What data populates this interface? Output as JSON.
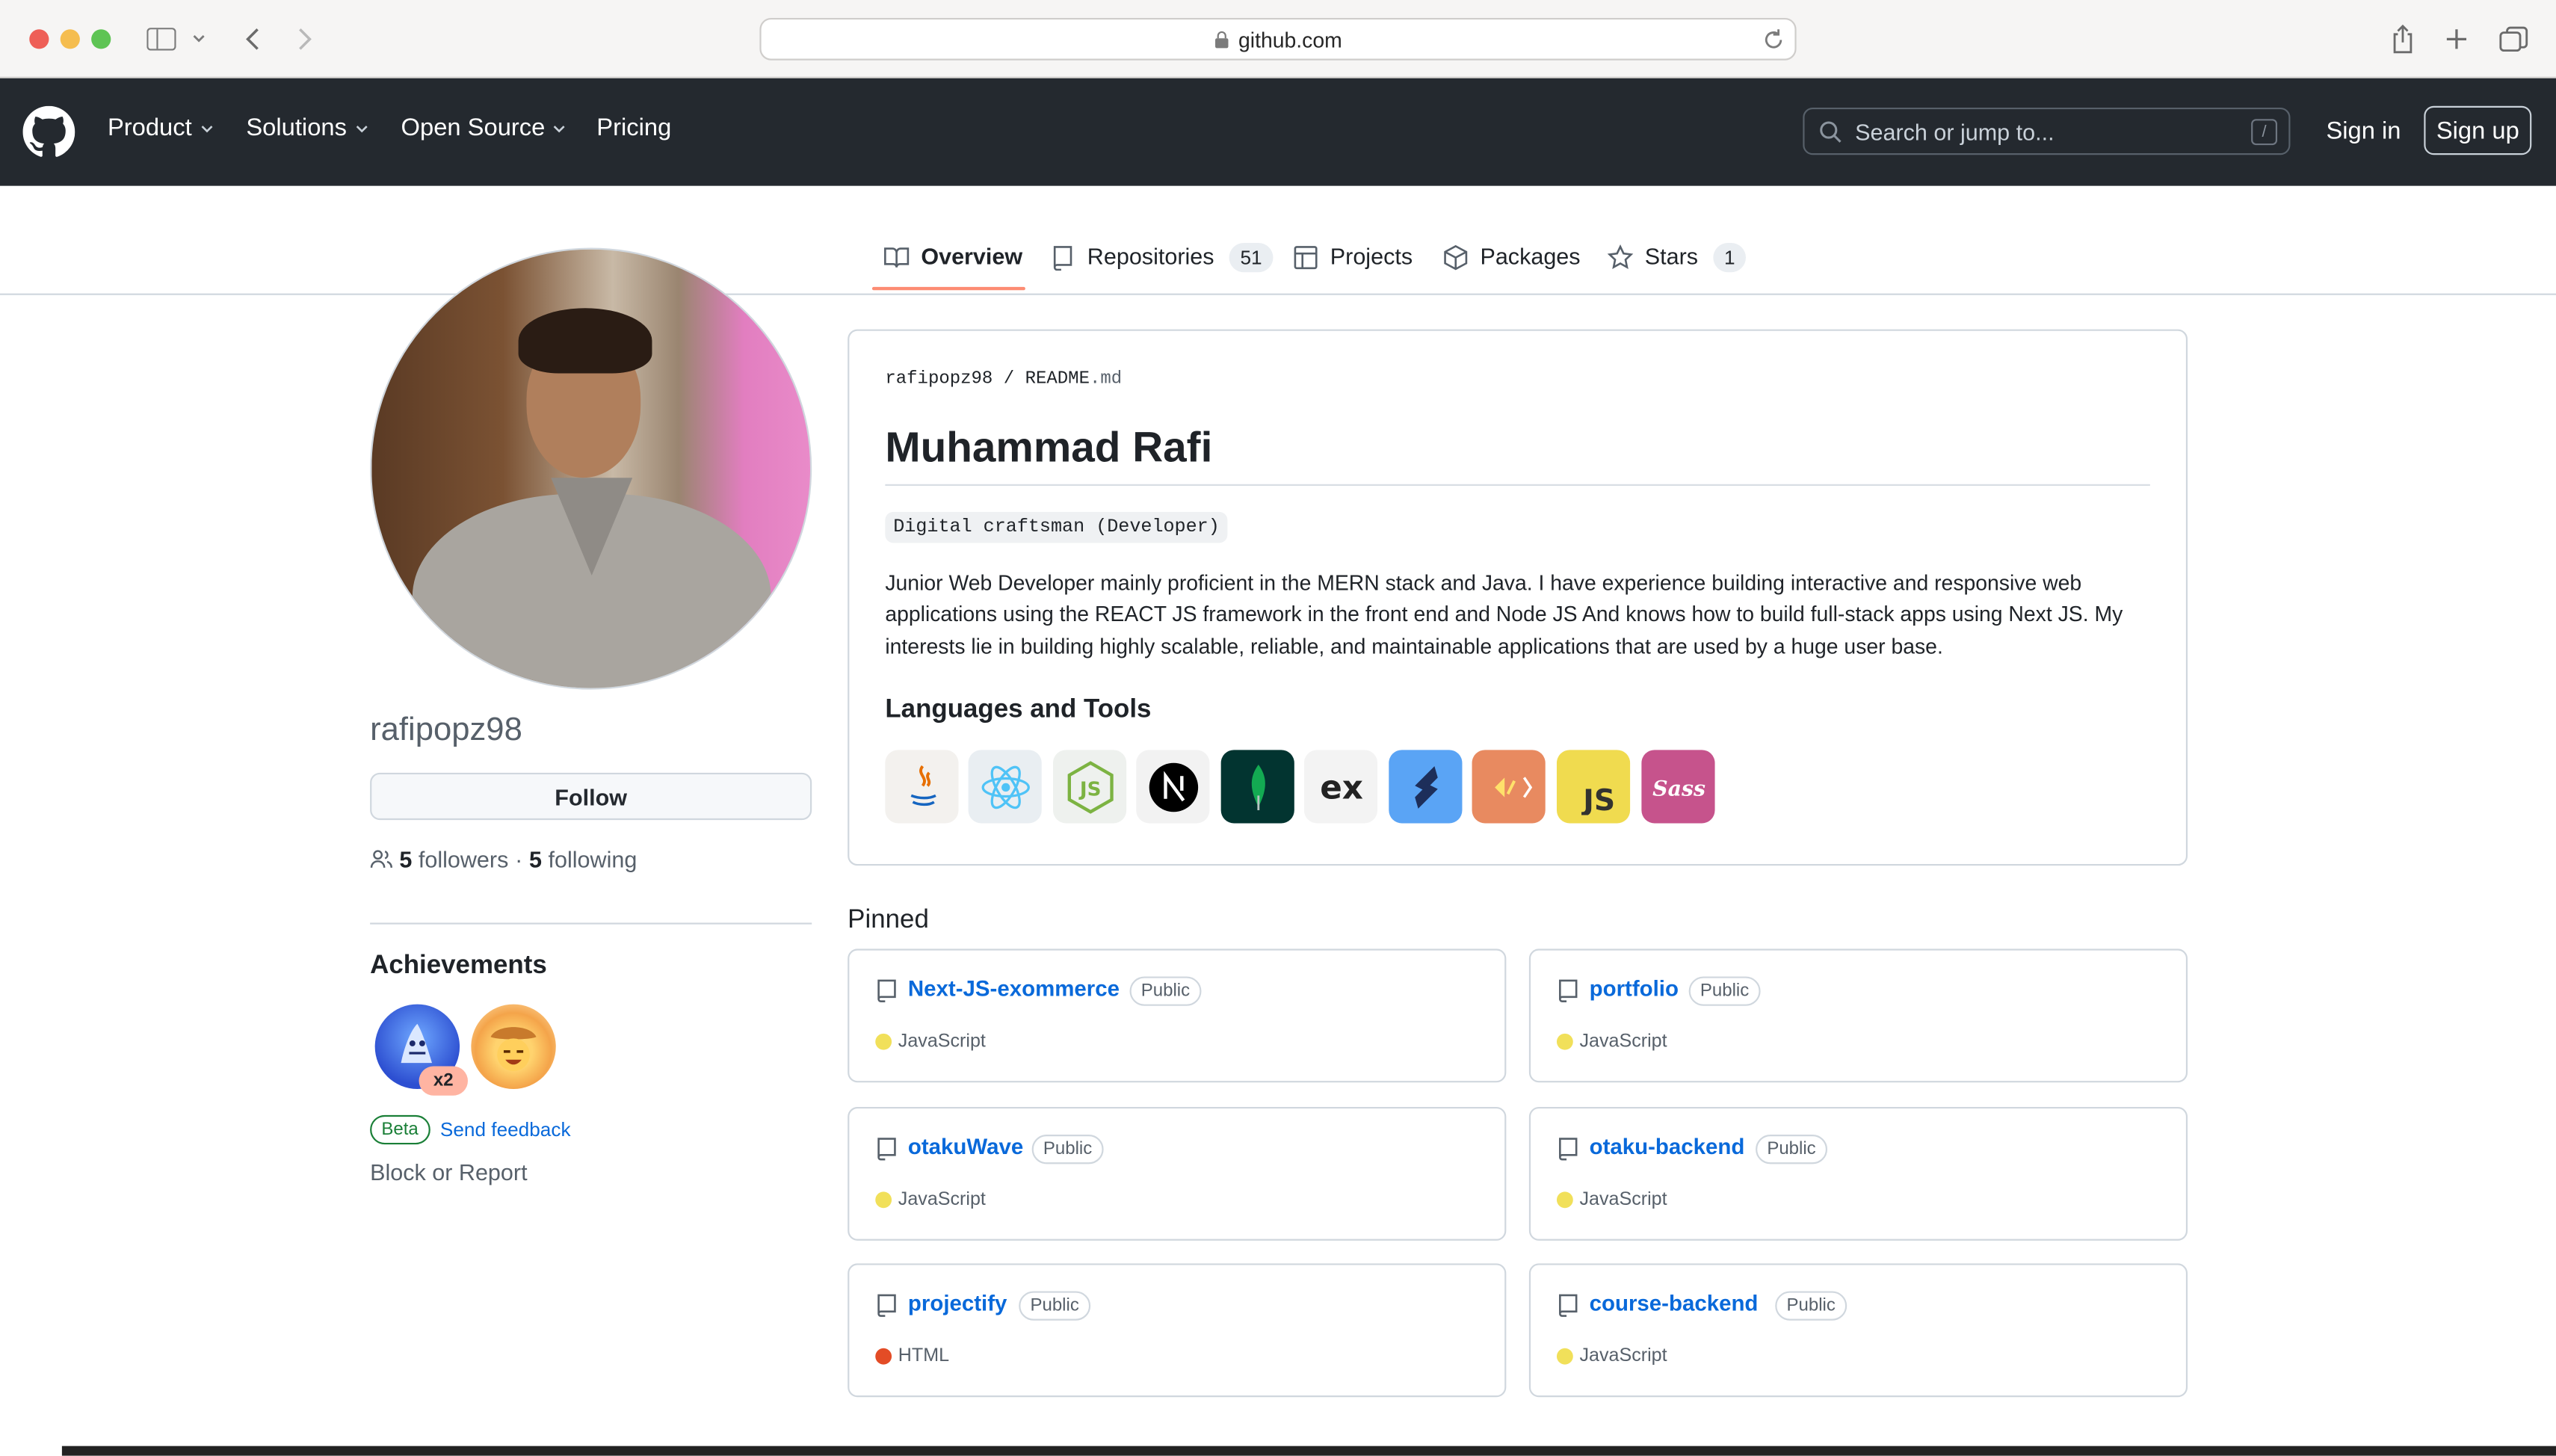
{
  "browser": {
    "url": "github.com"
  },
  "header": {
    "nav": [
      {
        "label": "Product",
        "has_menu": true
      },
      {
        "label": "Solutions",
        "has_menu": true
      },
      {
        "label": "Open Source",
        "has_menu": true
      },
      {
        "label": "Pricing",
        "has_menu": false
      }
    ],
    "search_placeholder": "Search or jump to...",
    "search_shortcut": "/",
    "sign_in": "Sign in",
    "sign_up": "Sign up"
  },
  "tabs": [
    {
      "label": "Overview",
      "icon": "book-icon",
      "count": null,
      "active": true
    },
    {
      "label": "Repositories",
      "icon": "repo-icon",
      "count": "51"
    },
    {
      "label": "Projects",
      "icon": "table-icon",
      "count": null
    },
    {
      "label": "Packages",
      "icon": "package-icon",
      "count": null
    },
    {
      "label": "Stars",
      "icon": "star-icon",
      "count": "1"
    }
  ],
  "profile": {
    "username": "rafipopz98",
    "follow_label": "Follow",
    "followers_count": "5",
    "followers_label": "followers",
    "separator": "·",
    "following_count": "5",
    "following_label": "following",
    "achievements_title": "Achievements",
    "achievement_multiplier": "x2",
    "beta_label": "Beta",
    "feedback_label": "Send feedback",
    "block_label": "Block or Report"
  },
  "readme": {
    "owner": "rafipopz98",
    "path_sep": "/",
    "file": "README",
    "ext": ".md",
    "name": "Muhammad Rafi",
    "tagline": "Digital craftsman (Developer)",
    "bio": "Junior Web Developer mainly proficient in the MERN stack and Java. I have experience building interactive and responsive web applications using the REACT JS framework in the front end and Node JS And knows how to build full-stack apps using Next JS. My interests lie in building highly scalable, reliable, and maintainable applications that are used by a huge user base.",
    "tools_heading": "Languages and Tools",
    "tools": [
      "java-icon",
      "react-icon",
      "nodejs-icon",
      "nextjs-icon",
      "mongodb-icon",
      "express-icon",
      "solidity-icon",
      "postman-icon",
      "javascript-icon",
      "sass-icon"
    ]
  },
  "pinned": {
    "title": "Pinned",
    "visibility_label": "Public",
    "repos": [
      {
        "name": "Next-JS-exommerce",
        "language": "JavaScript",
        "color": "#f1e05a"
      },
      {
        "name": "portfolio",
        "language": "JavaScript",
        "color": "#f1e05a"
      },
      {
        "name": "otakuWave",
        "language": "JavaScript",
        "color": "#f1e05a"
      },
      {
        "name": "otaku-backend",
        "language": "JavaScript",
        "color": "#f1e05a"
      },
      {
        "name": "projectify",
        "language": "HTML",
        "color": "#e34c26"
      },
      {
        "name": "course-backend",
        "language": "JavaScript",
        "color": "#f1e05a"
      }
    ]
  },
  "colors": {
    "header_bg": "#24292f",
    "link": "#0969da",
    "tab_underline": "#fd8c73"
  }
}
